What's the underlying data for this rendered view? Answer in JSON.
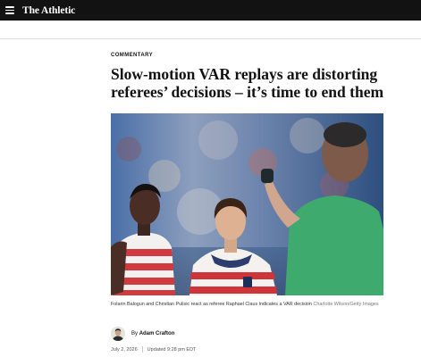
{
  "header": {
    "menu_icon": "hamburger-menu-icon",
    "logo_text": "The Athletic",
    "background": "#121212"
  },
  "article": {
    "kicker": "COMMENTARY",
    "headline": "Slow-motion VAR replays are distorting referees’ decisions – it’s time to end them",
    "image": {
      "caption": "Folarin Balogun and Christian Pulisic react as referee Raphael Claus indicates a VAR decision",
      "credit": "Charlotte Wilson/Getty Images"
    },
    "byline": {
      "prefix": "By",
      "author": "Adam Crafton"
    },
    "date": "July 2, 2026",
    "updated": "Updated 9:28 pm EDT"
  }
}
